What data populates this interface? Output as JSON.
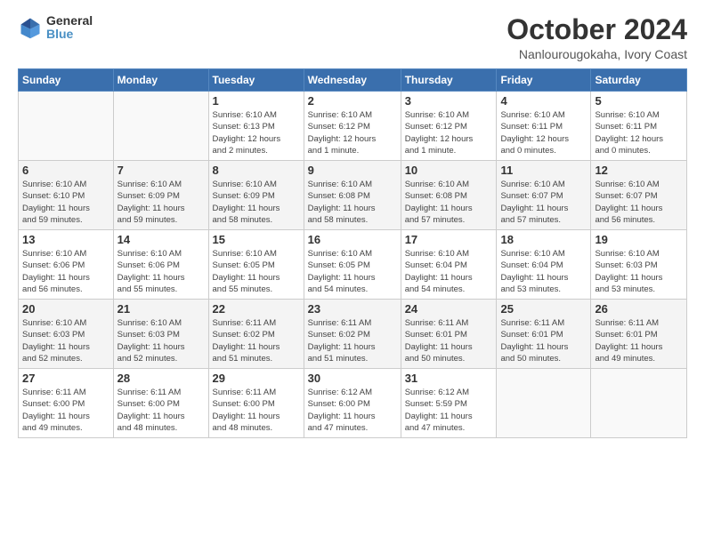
{
  "logo": {
    "line1": "General",
    "line2": "Blue"
  },
  "title": "October 2024",
  "location": "Nanlourougokaha, Ivory Coast",
  "days_header": [
    "Sunday",
    "Monday",
    "Tuesday",
    "Wednesday",
    "Thursday",
    "Friday",
    "Saturday"
  ],
  "weeks": [
    [
      {
        "day": "",
        "info": ""
      },
      {
        "day": "",
        "info": ""
      },
      {
        "day": "1",
        "info": "Sunrise: 6:10 AM\nSunset: 6:13 PM\nDaylight: 12 hours\nand 2 minutes."
      },
      {
        "day": "2",
        "info": "Sunrise: 6:10 AM\nSunset: 6:12 PM\nDaylight: 12 hours\nand 1 minute."
      },
      {
        "day": "3",
        "info": "Sunrise: 6:10 AM\nSunset: 6:12 PM\nDaylight: 12 hours\nand 1 minute."
      },
      {
        "day": "4",
        "info": "Sunrise: 6:10 AM\nSunset: 6:11 PM\nDaylight: 12 hours\nand 0 minutes."
      },
      {
        "day": "5",
        "info": "Sunrise: 6:10 AM\nSunset: 6:11 PM\nDaylight: 12 hours\nand 0 minutes."
      }
    ],
    [
      {
        "day": "6",
        "info": "Sunrise: 6:10 AM\nSunset: 6:10 PM\nDaylight: 11 hours\nand 59 minutes."
      },
      {
        "day": "7",
        "info": "Sunrise: 6:10 AM\nSunset: 6:09 PM\nDaylight: 11 hours\nand 59 minutes."
      },
      {
        "day": "8",
        "info": "Sunrise: 6:10 AM\nSunset: 6:09 PM\nDaylight: 11 hours\nand 58 minutes."
      },
      {
        "day": "9",
        "info": "Sunrise: 6:10 AM\nSunset: 6:08 PM\nDaylight: 11 hours\nand 58 minutes."
      },
      {
        "day": "10",
        "info": "Sunrise: 6:10 AM\nSunset: 6:08 PM\nDaylight: 11 hours\nand 57 minutes."
      },
      {
        "day": "11",
        "info": "Sunrise: 6:10 AM\nSunset: 6:07 PM\nDaylight: 11 hours\nand 57 minutes."
      },
      {
        "day": "12",
        "info": "Sunrise: 6:10 AM\nSunset: 6:07 PM\nDaylight: 11 hours\nand 56 minutes."
      }
    ],
    [
      {
        "day": "13",
        "info": "Sunrise: 6:10 AM\nSunset: 6:06 PM\nDaylight: 11 hours\nand 56 minutes."
      },
      {
        "day": "14",
        "info": "Sunrise: 6:10 AM\nSunset: 6:06 PM\nDaylight: 11 hours\nand 55 minutes."
      },
      {
        "day": "15",
        "info": "Sunrise: 6:10 AM\nSunset: 6:05 PM\nDaylight: 11 hours\nand 55 minutes."
      },
      {
        "day": "16",
        "info": "Sunrise: 6:10 AM\nSunset: 6:05 PM\nDaylight: 11 hours\nand 54 minutes."
      },
      {
        "day": "17",
        "info": "Sunrise: 6:10 AM\nSunset: 6:04 PM\nDaylight: 11 hours\nand 54 minutes."
      },
      {
        "day": "18",
        "info": "Sunrise: 6:10 AM\nSunset: 6:04 PM\nDaylight: 11 hours\nand 53 minutes."
      },
      {
        "day": "19",
        "info": "Sunrise: 6:10 AM\nSunset: 6:03 PM\nDaylight: 11 hours\nand 53 minutes."
      }
    ],
    [
      {
        "day": "20",
        "info": "Sunrise: 6:10 AM\nSunset: 6:03 PM\nDaylight: 11 hours\nand 52 minutes."
      },
      {
        "day": "21",
        "info": "Sunrise: 6:10 AM\nSunset: 6:03 PM\nDaylight: 11 hours\nand 52 minutes."
      },
      {
        "day": "22",
        "info": "Sunrise: 6:11 AM\nSunset: 6:02 PM\nDaylight: 11 hours\nand 51 minutes."
      },
      {
        "day": "23",
        "info": "Sunrise: 6:11 AM\nSunset: 6:02 PM\nDaylight: 11 hours\nand 51 minutes."
      },
      {
        "day": "24",
        "info": "Sunrise: 6:11 AM\nSunset: 6:01 PM\nDaylight: 11 hours\nand 50 minutes."
      },
      {
        "day": "25",
        "info": "Sunrise: 6:11 AM\nSunset: 6:01 PM\nDaylight: 11 hours\nand 50 minutes."
      },
      {
        "day": "26",
        "info": "Sunrise: 6:11 AM\nSunset: 6:01 PM\nDaylight: 11 hours\nand 49 minutes."
      }
    ],
    [
      {
        "day": "27",
        "info": "Sunrise: 6:11 AM\nSunset: 6:00 PM\nDaylight: 11 hours\nand 49 minutes."
      },
      {
        "day": "28",
        "info": "Sunrise: 6:11 AM\nSunset: 6:00 PM\nDaylight: 11 hours\nand 48 minutes."
      },
      {
        "day": "29",
        "info": "Sunrise: 6:11 AM\nSunset: 6:00 PM\nDaylight: 11 hours\nand 48 minutes."
      },
      {
        "day": "30",
        "info": "Sunrise: 6:12 AM\nSunset: 6:00 PM\nDaylight: 11 hours\nand 47 minutes."
      },
      {
        "day": "31",
        "info": "Sunrise: 6:12 AM\nSunset: 5:59 PM\nDaylight: 11 hours\nand 47 minutes."
      },
      {
        "day": "",
        "info": ""
      },
      {
        "day": "",
        "info": ""
      }
    ]
  ]
}
